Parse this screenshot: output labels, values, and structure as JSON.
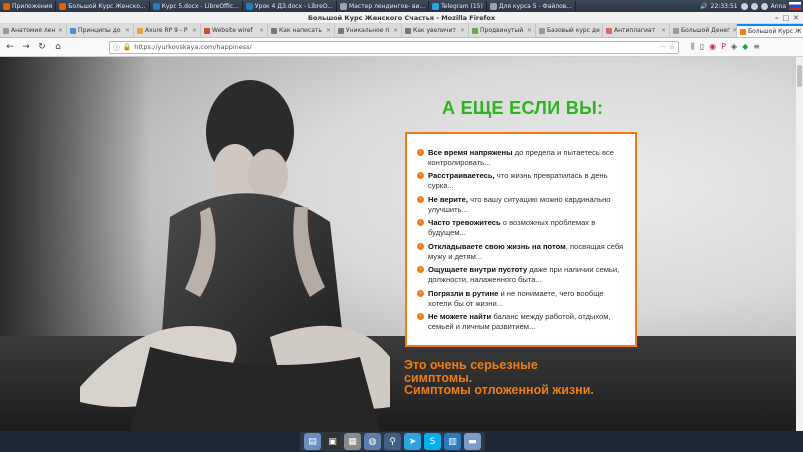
{
  "taskbar": {
    "apps_label": "Приложения",
    "tasks": [
      {
        "label": "Большой Курс Женско...",
        "color": "#e66000"
      },
      {
        "label": "Курс 5.docx - LibreOffic...",
        "color": "#2a7ac0"
      },
      {
        "label": "Урок 4 ДЗ.docx - LibreO...",
        "color": "#2a7ac0"
      },
      {
        "label": "Мастер лендингов- ви...",
        "color": "#9aa4b0"
      },
      {
        "label": "Telegram (15)",
        "color": "#2ca5e0"
      },
      {
        "label": "Для курса 5 - Файлов...",
        "color": "#9aa4b0"
      }
    ],
    "clock": "22:33:51",
    "user": "Anna"
  },
  "window": {
    "title": "Большой Курс Женского Счастья - Mozilla Firefox",
    "controls": [
      "–",
      "□",
      "✕"
    ]
  },
  "tabs": [
    {
      "label": "Анатомия лен",
      "color": "#999999",
      "active": false
    },
    {
      "label": "Принципы до",
      "color": "#4a90d9",
      "active": false
    },
    {
      "label": "Axure RP 9 - P",
      "color": "#e8a33d",
      "active": false
    },
    {
      "label": "Website wiref",
      "color": "#d44638",
      "active": false
    },
    {
      "label": "Как написать",
      "color": "#777777",
      "active": false
    },
    {
      "label": "Уникальное п",
      "color": "#777777",
      "active": false
    },
    {
      "label": "Как увеличит",
      "color": "#777777",
      "active": false
    },
    {
      "label": "Продвинутый",
      "color": "#6aa84f",
      "active": false
    },
    {
      "label": "Базовый курс де",
      "color": "#999999",
      "active": false
    },
    {
      "label": "Антиплагиат",
      "color": "#e06666",
      "active": false
    },
    {
      "label": "Большой Денег",
      "color": "#999999",
      "active": false
    },
    {
      "label": "Большой Курс Ж",
      "color": "#ef7d14",
      "active": true
    }
  ],
  "navbar": {
    "url": "https://yurkovskaya.com/happiness/",
    "back": "←",
    "forward": "→",
    "reload": "↻",
    "home": "⌂"
  },
  "page": {
    "headline": "А ЕЩЕ ЕСЛИ ВЫ:",
    "items": [
      {
        "bold": "Все время напряжены",
        "rest": " до предела и пытаетесь все контролировать..."
      },
      {
        "bold": "Расстраиваетесь,",
        "rest": " что жизнь превратилась в день сурка..."
      },
      {
        "bold": "Не верите,",
        "rest": " что вашу ситуацию можно кардинально улучшить..."
      },
      {
        "bold": "Часто тревожитесь",
        "rest": " о возможных проблемах в будущем..."
      },
      {
        "bold": "Откладываете свою жизнь на потом",
        "rest": ", посвящая себя мужу и детям..."
      },
      {
        "bold": "Ощущаете внутри пустоту",
        "rest": " даже при наличии семьи, должности, налаженного быта..."
      },
      {
        "bold": "Погрязли в рутине",
        "rest": " и не понимаете, чего вообще хотели бы от жизни..."
      },
      {
        "bold": "Не можете найти",
        "rest": " баланс между работой, отдыхом, семьей и личным развитием..."
      }
    ],
    "tagline_1": "Это очень серьезные",
    "tagline_2": "симптомы.",
    "tagline_3": "Симптомы отложенной жизни.",
    "accent": "#ef7d14",
    "headline_color": "#2cb31e"
  },
  "dock": [
    {
      "name": "files-icon",
      "color": "#6a8fbf",
      "glyph": "▤"
    },
    {
      "name": "terminal-icon",
      "color": "#333333",
      "glyph": "▣"
    },
    {
      "name": "sheet-icon",
      "color": "#8a8a8a",
      "glyph": "▦"
    },
    {
      "name": "globe-icon",
      "color": "#5b7ea8",
      "glyph": "◍"
    },
    {
      "name": "search-icon",
      "color": "#3f5f87",
      "glyph": "⚲"
    },
    {
      "name": "telegram-icon",
      "color": "#2ca5e0",
      "glyph": "➤"
    },
    {
      "name": "skype-icon",
      "color": "#00aff0",
      "glyph": "S"
    },
    {
      "name": "document-icon",
      "color": "#2a7ac0",
      "glyph": "▥"
    },
    {
      "name": "folder-icon",
      "color": "#7a9cc7",
      "glyph": "▬"
    }
  ]
}
